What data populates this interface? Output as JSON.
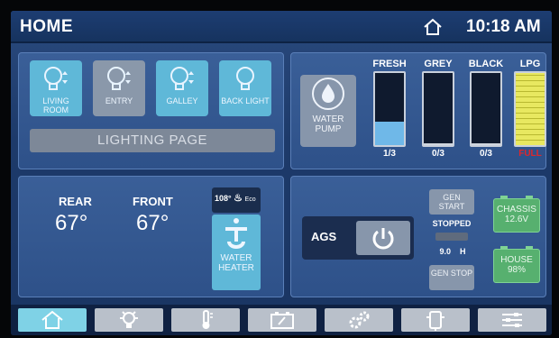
{
  "header": {
    "title": "HOME",
    "time": "10:18 AM",
    "home_icon": "home-icon"
  },
  "lighting": {
    "buttons": [
      {
        "label": "LIVING ROOM",
        "on": true
      },
      {
        "label": "ENTRY",
        "on": false
      },
      {
        "label": "GALLEY",
        "on": true
      },
      {
        "label": "BACK LIGHT",
        "on": true
      }
    ],
    "page_label": "LIGHTING PAGE"
  },
  "water_pump": {
    "label": "WATER PUMP"
  },
  "tanks": [
    {
      "name": "FRESH",
      "level": "1/3",
      "fill": 0.33,
      "color": "#6fb8e8"
    },
    {
      "name": "GREY",
      "level": "0/3",
      "fill": 0.02,
      "color": "#d0d6de"
    },
    {
      "name": "BLACK",
      "level": "0/3",
      "fill": 0.02,
      "color": "#d0d6de"
    },
    {
      "name": "LPG",
      "level": "FULL",
      "fill": 1.0,
      "color": "#e8e860",
      "level_color": "#e0262a"
    }
  ],
  "temps": {
    "rear_label": "REAR",
    "rear_value": "67°",
    "front_label": "FRONT",
    "front_value": "67°"
  },
  "water_heater": {
    "setting": "108°",
    "mode": "Eco",
    "label": "WATER HEATER"
  },
  "generator": {
    "ags_label": "AGS",
    "start_label": "GEN START",
    "status": "STOPPED",
    "hours": "9.0",
    "hours_unit": "H",
    "stop_label": "GEN STOP"
  },
  "batteries": {
    "chassis_label": "CHASSIS",
    "chassis_value": "12.6V",
    "house_label": "HOUSE",
    "house_value": "98%"
  },
  "nav": [
    "home-icon",
    "light-bulb-icon",
    "thermometer-icon",
    "battery-icon",
    "gears-icon",
    "pump-icon",
    "settings-sliders-icon"
  ],
  "colors": {
    "accent": "#5fb8d8",
    "battery": "#57b06f",
    "lpg": "#e8e860",
    "alert": "#e0262a"
  }
}
